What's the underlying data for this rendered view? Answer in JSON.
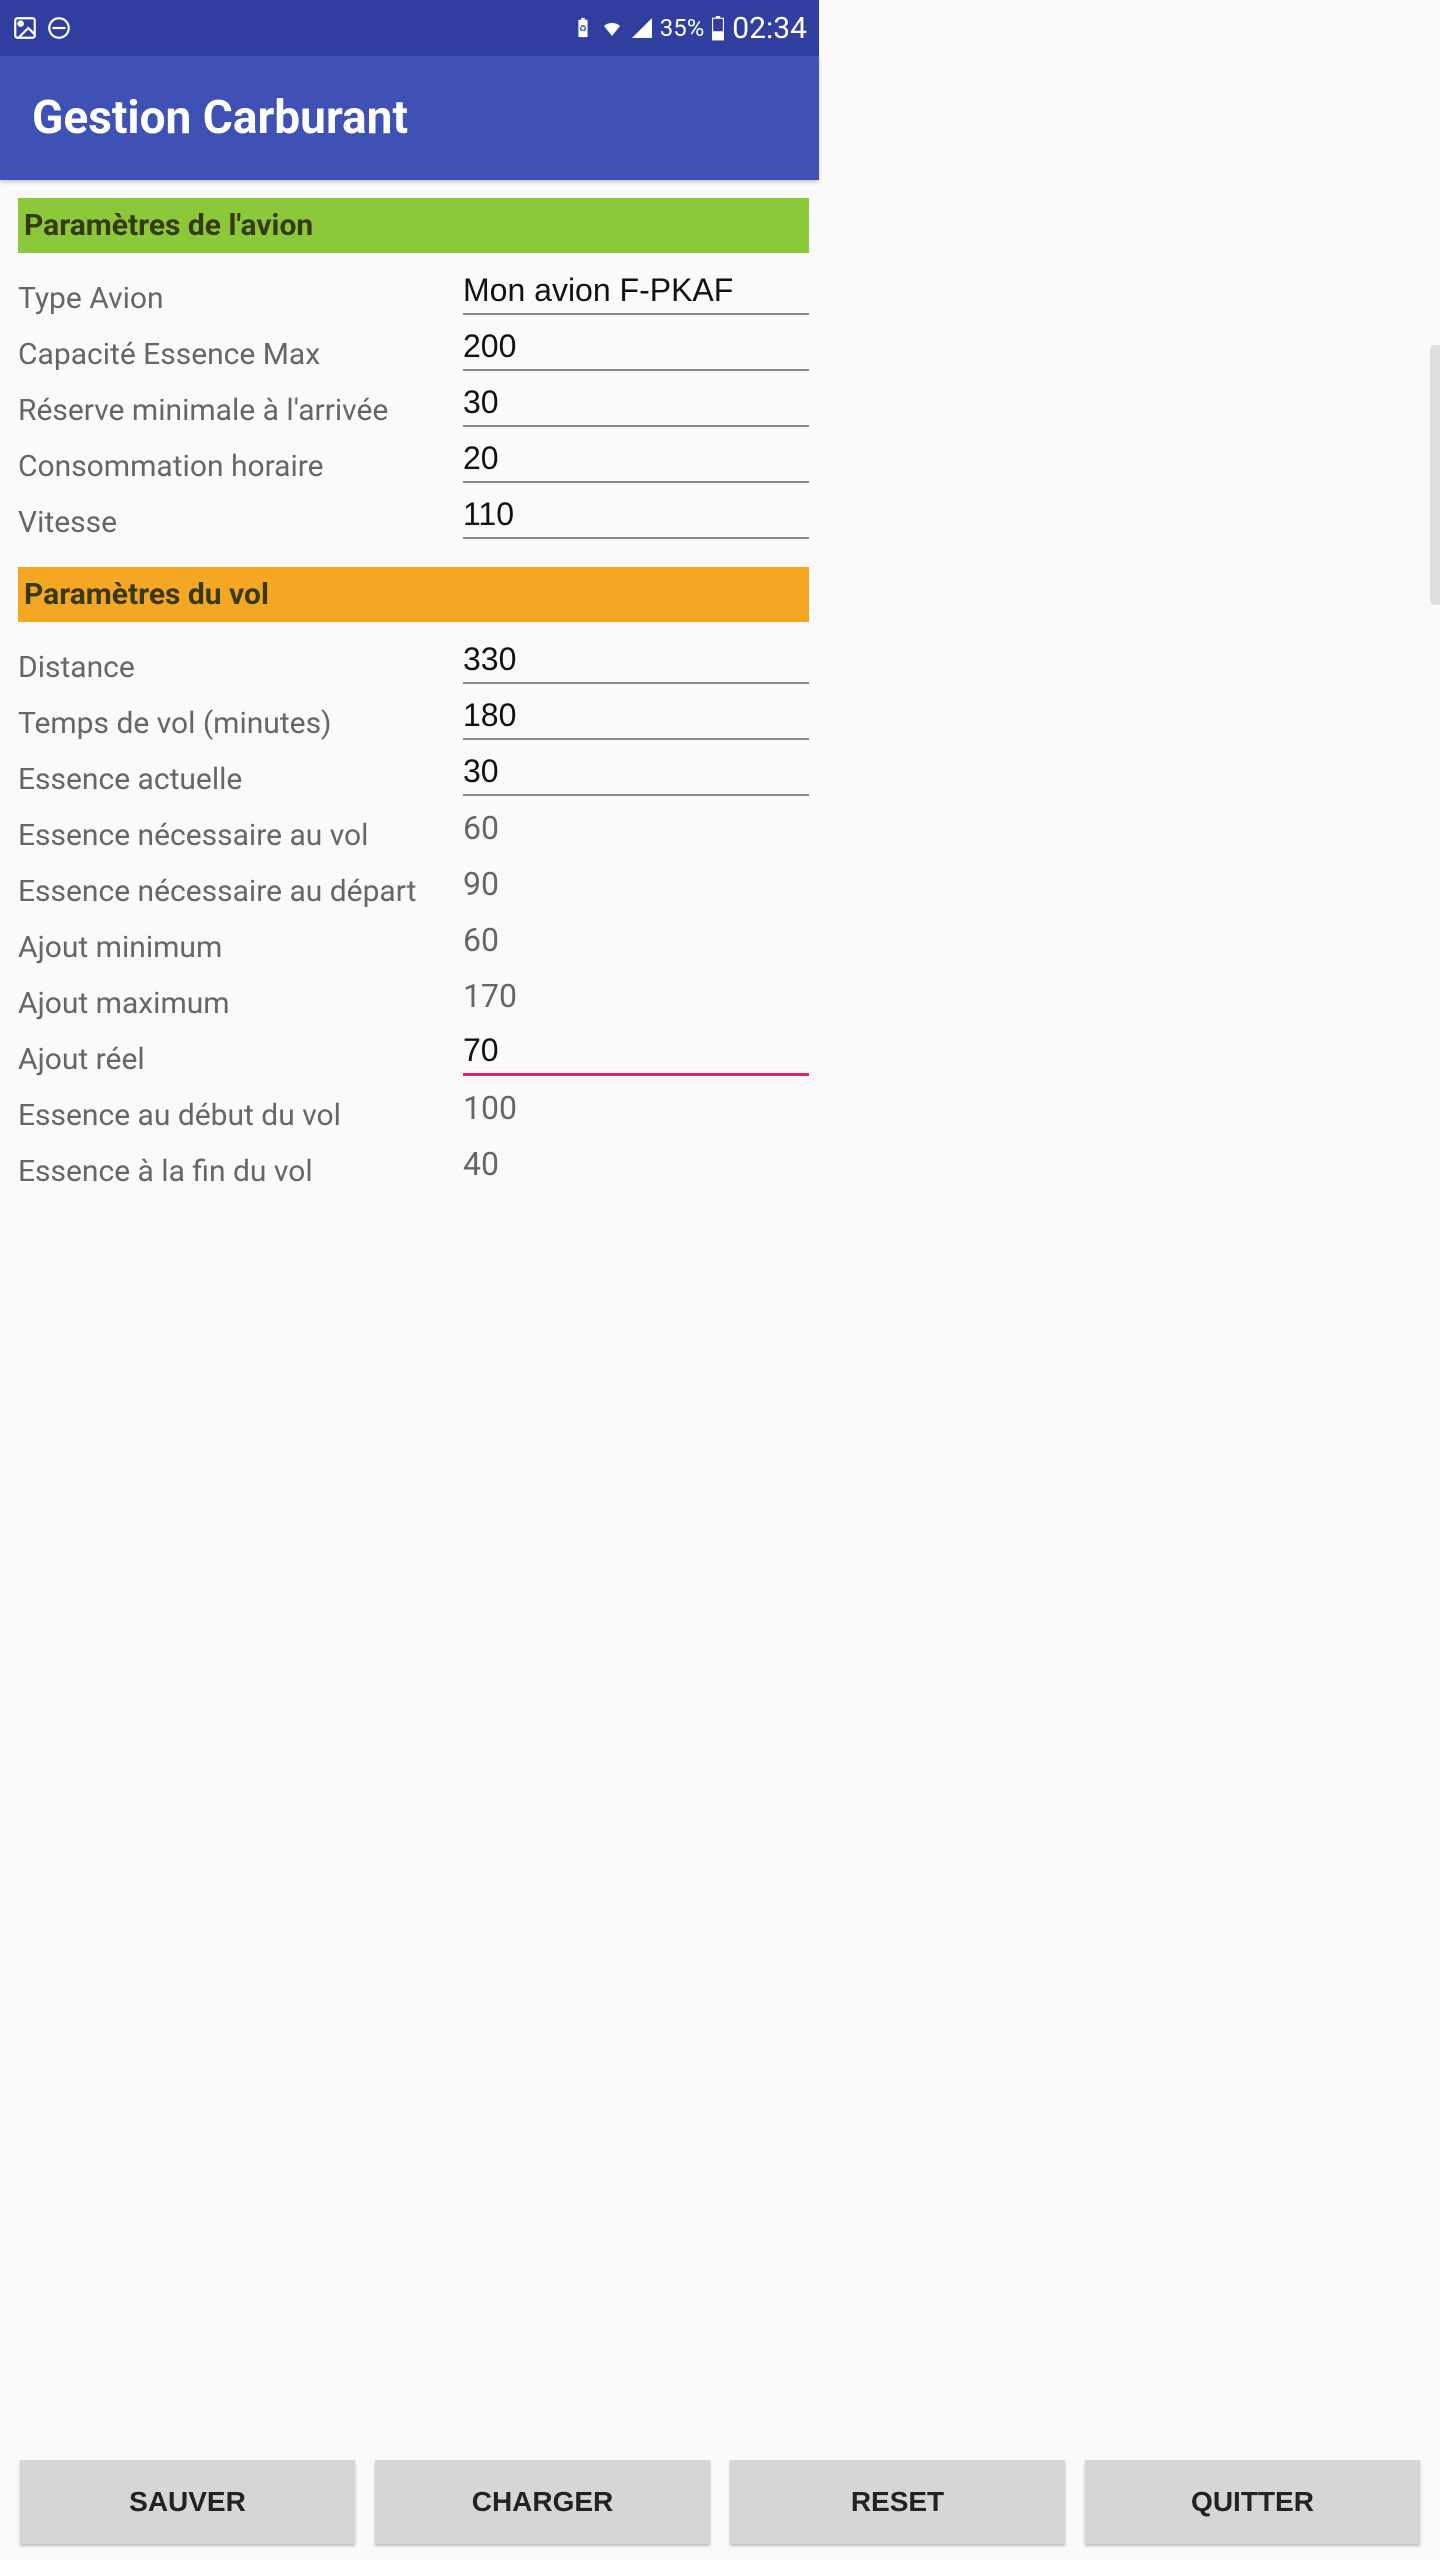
{
  "status_bar": {
    "battery": "35%",
    "time": "02:34"
  },
  "app": {
    "title": "Gestion Carburant"
  },
  "sections": {
    "plane": {
      "header": "Paramètres de l'avion",
      "type_label": "Type Avion",
      "type_value": "Mon avion F-PKAF",
      "capacity_label": "Capacité Essence Max",
      "capacity_value": "200",
      "reserve_label": "Réserve minimale à l'arrivée",
      "reserve_value": "30",
      "consumption_label": "Consommation horaire",
      "consumption_value": "20",
      "speed_label": "Vitesse",
      "speed_value": "110"
    },
    "flight": {
      "header": "Paramètres du vol",
      "distance_label": "Distance",
      "distance_value": "330",
      "flighttime_label": "Temps de vol (minutes)",
      "flighttime_value": "180",
      "currentfuel_label": "Essence actuelle",
      "currentfuel_value": "30",
      "fuelneeded_label": "Essence nécessaire au vol",
      "fuelneeded_value": "60",
      "fueldepart_label": "Essence nécessaire au départ",
      "fueldepart_value": "90",
      "addmin_label": "Ajout minimum",
      "addmin_value": "60",
      "addmax_label": "Ajout maximum",
      "addmax_value": "170",
      "addreal_label": "Ajout réel",
      "addreal_value": "70",
      "fuelstart_label": "Essence au début du vol",
      "fuelstart_value": "100",
      "fuelend_label": "Essence à la fin du vol",
      "fuelend_value": "40"
    }
  },
  "buttons": {
    "save": "SAUVER",
    "load": "CHARGER",
    "reset": "RESET",
    "quit": "QUITTER"
  }
}
